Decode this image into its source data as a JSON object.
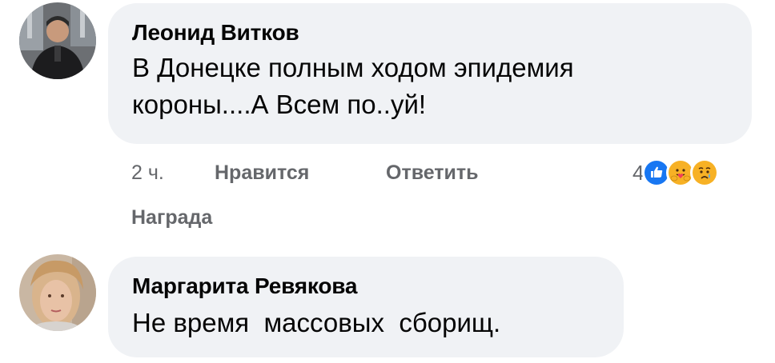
{
  "comments": [
    {
      "author": "Леонид Витков",
      "text_line1": "В Донецке полным ходом эпидемия",
      "text_line2": "короны....А Всем по..уй!",
      "time": "2 ч.",
      "like_label": "Нравится",
      "reply_label": "Ответить",
      "award_label": "Награда",
      "reaction_count": "4",
      "reactions": [
        "like-icon",
        "care-icon",
        "sad-icon"
      ]
    },
    {
      "author": "Маргарита Ревякова",
      "text": "Не время  массовых  сборищ."
    }
  ],
  "colors": {
    "bubble": "#f0f2f5",
    "meta_text": "#65676b",
    "like_blue": "#1877f2",
    "emoji_yellow": "#f7b125"
  }
}
